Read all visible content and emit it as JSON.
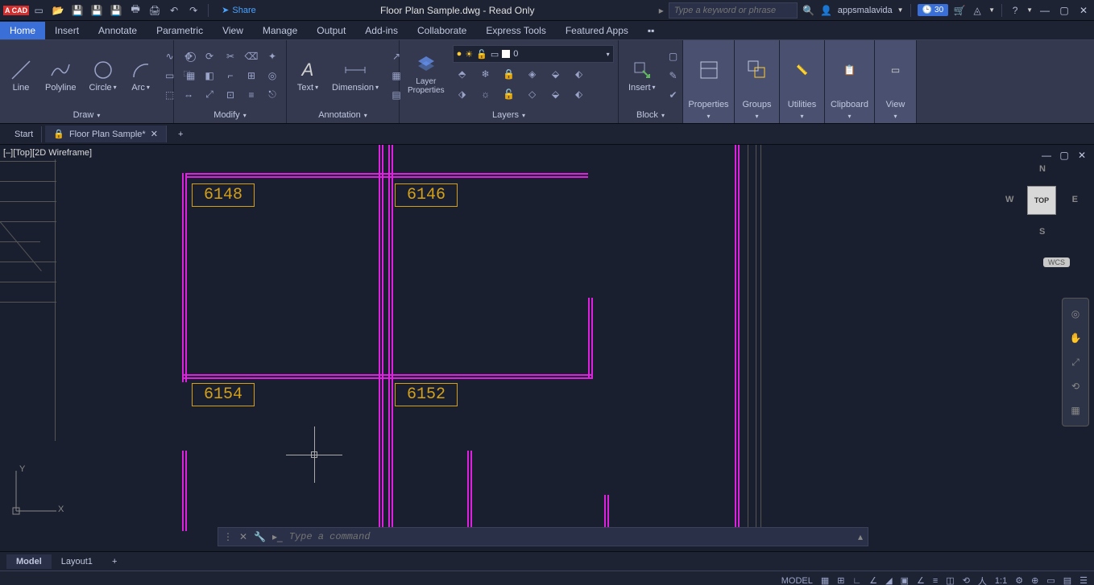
{
  "titlebar": {
    "app_badge": "CAD",
    "share": "Share",
    "title": "Floor Plan Sample.dwg - Read Only",
    "search_placeholder": "Type a keyword or phrase",
    "username": "appsmalavida",
    "trial": "30"
  },
  "ribbon_tabs": [
    "Home",
    "Insert",
    "Annotate",
    "Parametric",
    "View",
    "Manage",
    "Output",
    "Add-ins",
    "Collaborate",
    "Express Tools",
    "Featured Apps"
  ],
  "draw": {
    "line": "Line",
    "polyline": "Polyline",
    "circle": "Circle",
    "arc": "Arc",
    "title": "Draw"
  },
  "modify": {
    "title": "Modify"
  },
  "annotation": {
    "text": "Text",
    "dimension": "Dimension",
    "title": "Annotation"
  },
  "layers": {
    "lp": "Layer Properties",
    "current": "0",
    "title": "Layers"
  },
  "block": {
    "insert": "Insert",
    "title": "Block"
  },
  "panels": {
    "properties": "Properties",
    "groups": "Groups",
    "utilities": "Utilities",
    "clipboard": "Clipboard",
    "view": "View"
  },
  "doc_tabs": {
    "start": "Start",
    "file": "Floor Plan Sample*"
  },
  "canvas": {
    "view_label": "[–][Top][2D Wireframe]",
    "rooms": {
      "a": "6148",
      "b": "6146",
      "c": "6154",
      "d": "6152"
    },
    "cube_top": "TOP",
    "n": "N",
    "s": "S",
    "e": "E",
    "w": "W",
    "wcs": "WCS",
    "y": "Y",
    "x": "X",
    "cmd_placeholder": "Type a command"
  },
  "layout_tabs": {
    "model": "Model",
    "layout1": "Layout1"
  },
  "status": {
    "model": "MODEL",
    "scale": "1:1",
    "plus": "+"
  }
}
